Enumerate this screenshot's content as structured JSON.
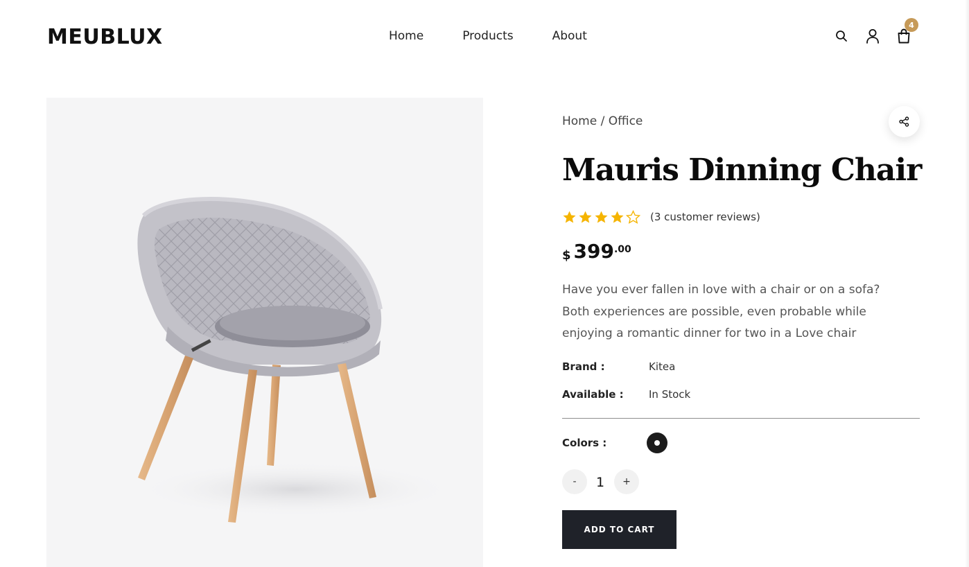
{
  "header": {
    "logo": "MEUBLUX",
    "nav": [
      "Home",
      "Products",
      "About"
    ],
    "icons": [
      "search-icon",
      "user-icon",
      "cart-icon"
    ],
    "cart_count": "4",
    "badge_color": "#c69a58"
  },
  "breadcrumb": {
    "home": "Home",
    "sep": " / ",
    "current": "Office"
  },
  "product": {
    "title": "Mauris Dinning Chair",
    "rating": 4,
    "rating_max": 5,
    "star_color": "#f5b400",
    "reviews": "(3 customer reviews)",
    "price_currency": "$",
    "price_int": "399",
    "price_dec": ".00",
    "description": [
      "Have you ever fallen in love with a chair or on a sofa?",
      "Both experiences are possible, even probable while",
      "enjoying a romantic dinner for two in a Love chair"
    ],
    "brand_label": "Brand :",
    "brand_value": "Kitea",
    "available_label": "Available :",
    "available_value": "In Stock",
    "colors_label": "Colors :",
    "selected_color": "#1c1c1c",
    "qty_minus": "-",
    "qty_value": "1",
    "qty_plus": "+",
    "add_to_cart": "ADD TO CART"
  }
}
